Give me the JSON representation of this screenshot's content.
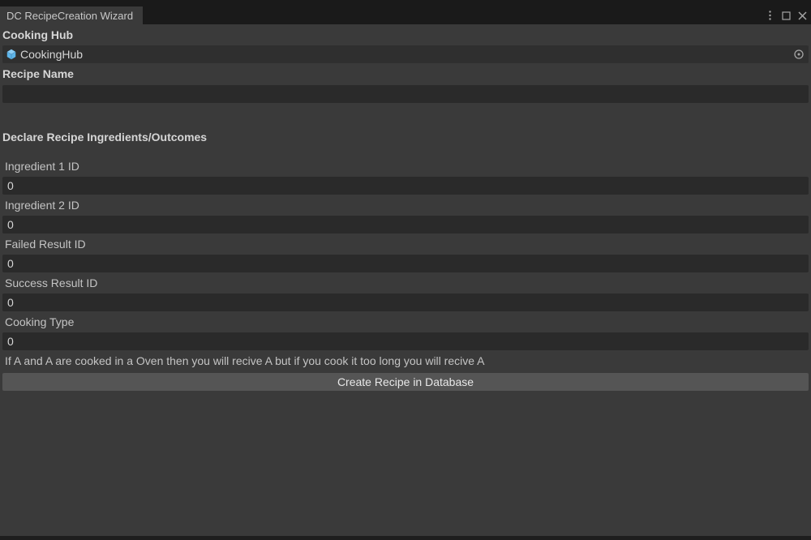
{
  "tab": {
    "title": "DC RecipeCreation Wizard"
  },
  "section_cooking_hub": {
    "label": "Cooking Hub",
    "object_name": "CookingHub"
  },
  "recipe_name": {
    "label": "Recipe Name",
    "value": ""
  },
  "ingredients_section": {
    "title": "Declare Recipe Ingredients/Outcomes"
  },
  "fields": {
    "ingredient1": {
      "label": "Ingredient 1 ID",
      "value": "0"
    },
    "ingredient2": {
      "label": "Ingredient 2 ID",
      "value": "0"
    },
    "failed_result": {
      "label": "Failed Result ID",
      "value": "0"
    },
    "success_result": {
      "label": "Success Result ID",
      "value": "0"
    },
    "cooking_type": {
      "label": "Cooking Type",
      "value": "0"
    }
  },
  "description": "If A and A are cooked in a Oven then you will recive A but if you cook it too long you will recive A",
  "button": {
    "create_label": "Create Recipe in Database"
  }
}
